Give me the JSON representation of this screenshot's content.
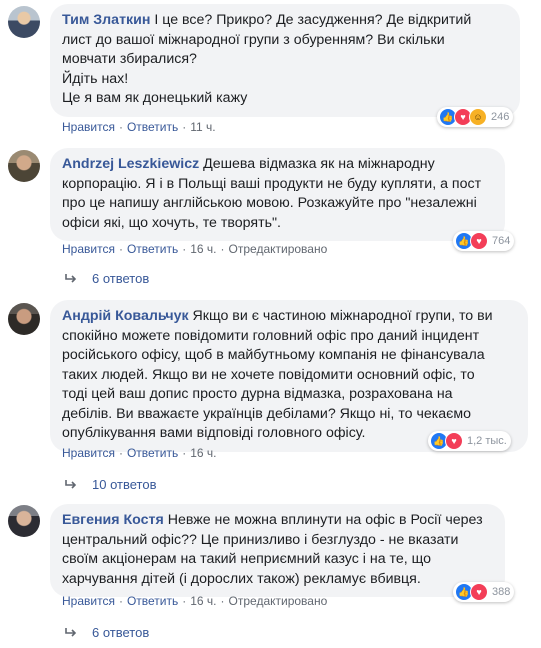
{
  "comments": [
    {
      "author": "Тим Златкин",
      "text": " І це все? Прикро? Де засудження? Де відкритий\nлист до вашої міжнародної групи з обуренням? Ви скільки\nмовчати збиралися?\nЙдіть нах!\nЦе я вам як донецький кажу",
      "like_label": "Нравится",
      "reply_label": "Ответить",
      "time": "11 ч.",
      "edited": "",
      "reaction_count": "246",
      "reaction_icons": [
        "like-icon",
        "love-icon",
        "haha-icon"
      ],
      "replies": ""
    },
    {
      "author": "Andrzej Leszkiewicz",
      "text": " Дешева відмазка як на міжнародну\nкорпорацію. Я і в Польщі ваші продукти не буду купляти, а пост\nпро це напишу англійською мовою. Розкажуйте про \"незалежні\nофіси які, що хочуть, те творять\".",
      "like_label": "Нравится",
      "reply_label": "Ответить",
      "time": "16 ч.",
      "edited": "Отредактировано",
      "reaction_count": "764",
      "reaction_icons": [
        "like-icon",
        "love-icon"
      ],
      "replies": "6 ответов"
    },
    {
      "author": "Андрій Ковальчук",
      "text": " Якщо ви є частиною міжнародної групи, то ви\nспокійно можете повідомити головний офіс про даний інцидент\nросійського офісу, щоб в майбутньому компанія не фінансувала\nтаких людей. Якщо ви не хочете повідомити основний офіс, то\nтоді цей ваш допис просто дурна відмазка, розрахована на\nдебілів. Ви вважаєте українців дебілами? Якщо ні, то чекаємо\nопублікування вами відповіді головного офісу.",
      "like_label": "Нравится",
      "reply_label": "Ответить",
      "time": "16 ч.",
      "edited": "",
      "reaction_count": "1,2 тыс.",
      "reaction_icons": [
        "like-icon",
        "love-icon"
      ],
      "replies": "10 ответов"
    },
    {
      "author": "Евгения Костя",
      "text": " Невже не можна вплинути на офіс в Росії через\nцентральний офіс?? Це принизливо і безглуздо - не вказати\nсвоїм акціонерам на такий неприємний казус і на те, що\nхарчування дітей (і дорослих також) рекламує вбивця.",
      "like_label": "Нравится",
      "reply_label": "Ответить",
      "time": "16 ч.",
      "edited": "Отредактировано",
      "reaction_count": "388",
      "reaction_icons": [
        "like-icon",
        "love-icon"
      ],
      "replies": "6 ответов"
    }
  ]
}
